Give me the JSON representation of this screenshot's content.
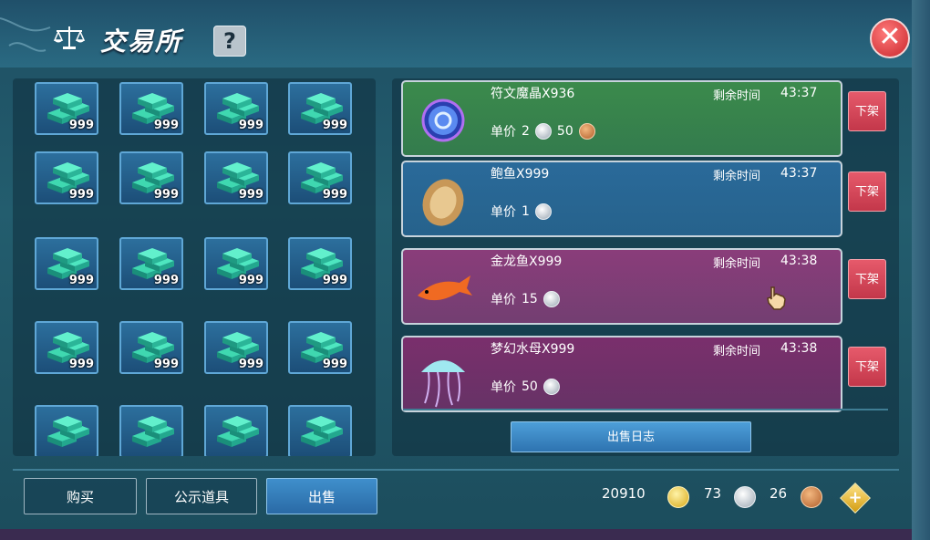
{
  "header": {
    "title": "交易所",
    "help_label": "?",
    "close_label": "✕"
  },
  "inventory": {
    "item_icon": "ingot-stack-icon",
    "slots": [
      {
        "count": "999"
      },
      {
        "count": "999"
      },
      {
        "count": "999"
      },
      {
        "count": "999"
      },
      {
        "count": "999"
      },
      {
        "count": "999"
      },
      {
        "count": "999"
      },
      {
        "count": "999"
      },
      {
        "count": "999"
      },
      {
        "count": "999"
      },
      {
        "count": "999"
      },
      {
        "count": "999"
      },
      {
        "count": "999"
      },
      {
        "count": "999"
      },
      {
        "count": "999"
      },
      {
        "count": "999"
      },
      {
        "count": ""
      },
      {
        "count": ""
      },
      {
        "count": ""
      },
      {
        "count": ""
      }
    ]
  },
  "listings": [
    {
      "name": "符文魔晶X936",
      "time_label": "剩余时间",
      "time": "43:37",
      "price_label": "单价",
      "price_silver": "2",
      "price_copper": "50",
      "delist_label": "下架",
      "icon": "rune-orb-icon",
      "color": "#3b8a4c"
    },
    {
      "name": "鲍鱼X999",
      "time_label": "剩余时间",
      "time": "43:37",
      "price_label": "单价",
      "price_silver": "1",
      "price_copper": "",
      "delist_label": "下架",
      "icon": "abalone-icon",
      "color": "#2a6a9a"
    },
    {
      "name": "金龙鱼X999",
      "time_label": "剩余时间",
      "time": "43:38",
      "price_label": "单价",
      "price_silver": "15",
      "price_copper": "",
      "delist_label": "下架",
      "icon": "arowana-fish-icon",
      "color": "#8a3d7a"
    },
    {
      "name": "梦幻水母X999",
      "time_label": "剩余时间",
      "time": "43:38",
      "price_label": "单价",
      "price_silver": "50",
      "price_copper": "",
      "delist_label": "下架",
      "icon": "jellyfish-icon",
      "color": "#7a2f6c"
    }
  ],
  "sale_log_label": "出售日志",
  "tabs": {
    "buy": "购买",
    "showcase": "公示道具",
    "sell": "出售"
  },
  "currency": {
    "gold": "20910",
    "silver": "73",
    "copper": "26",
    "add_label": "+"
  }
}
